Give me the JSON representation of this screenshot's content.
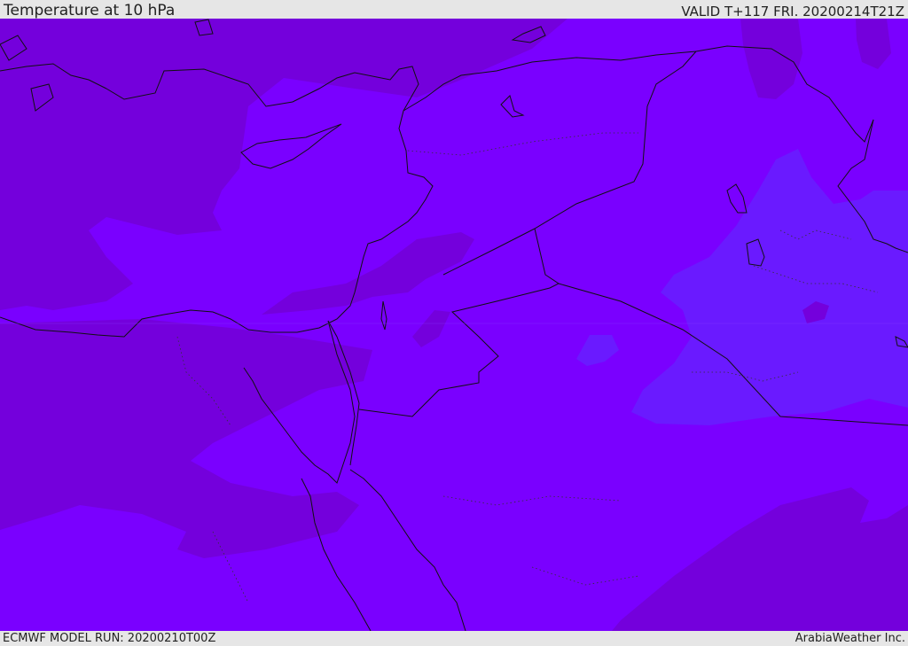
{
  "header": {
    "title": "Temperature at 10 hPa",
    "valid": "VALID T+117 FRI. 20200214T21Z"
  },
  "footer": {
    "model_run": "ECMWF MODEL RUN: 20200210T00Z",
    "provider": "ArabiaWeather Inc."
  },
  "colors": {
    "base": "#7a00ff",
    "warm_band": "#7400dc",
    "cool_patch": "#6a1aff",
    "coastline": "#111111"
  }
}
